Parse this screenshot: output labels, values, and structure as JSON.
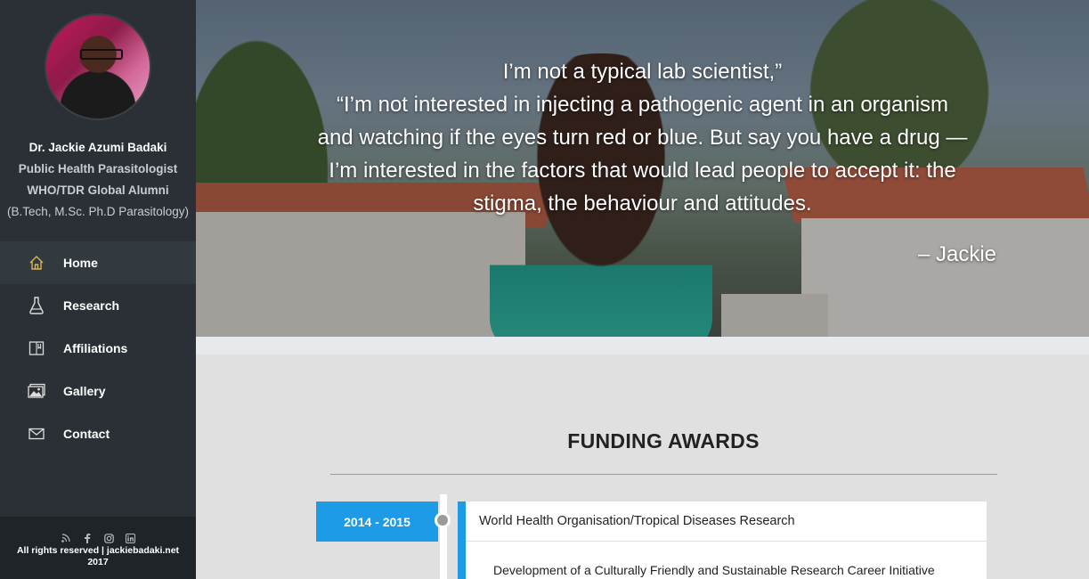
{
  "profile": {
    "name": "Dr. Jackie Azumi Badaki",
    "title": "Public Health Parasitologist",
    "affiliation": "WHO/TDR Global Alumni",
    "degrees": "(B.Tech, M.Sc. Ph.D Parasitology)"
  },
  "nav": [
    {
      "label": "Home",
      "icon": "home-icon",
      "active": true
    },
    {
      "label": "Research",
      "icon": "flask-icon",
      "active": false
    },
    {
      "label": "Affiliations",
      "icon": "book-icon",
      "active": false
    },
    {
      "label": "Gallery",
      "icon": "gallery-icon",
      "active": false
    },
    {
      "label": "Contact",
      "icon": "mail-icon",
      "active": false
    }
  ],
  "footer": {
    "social": [
      "rss-icon",
      "facebook-icon",
      "instagram-icon",
      "linkedin-icon"
    ],
    "copyright_line1": "All rights reserved | jackiebadaki.net",
    "copyright_line2": "2017"
  },
  "hero": {
    "quote_lines": [
      "I’m not a typical lab scientist,”",
      "“I’m not interested in injecting a pathogenic agent in an organism",
      "and watching if the eyes turn red or blue. But say you have a drug —",
      "I’m interested in the factors that would lead people to accept it: the",
      "stigma, the behaviour and attitudes."
    ],
    "author": "– Jackie"
  },
  "funding": {
    "title": "FUNDING AWARDS",
    "items": [
      {
        "years": "2014 - 2015",
        "organization": "World Health Organisation/Tropical Diseases Research",
        "description": "Development of a Culturally Friendly and Sustainable Research Career Initiative"
      }
    ]
  },
  "colors": {
    "sidebar": "#2a3035",
    "accent": "#1e9be6",
    "home_icon": "#d6b656"
  }
}
